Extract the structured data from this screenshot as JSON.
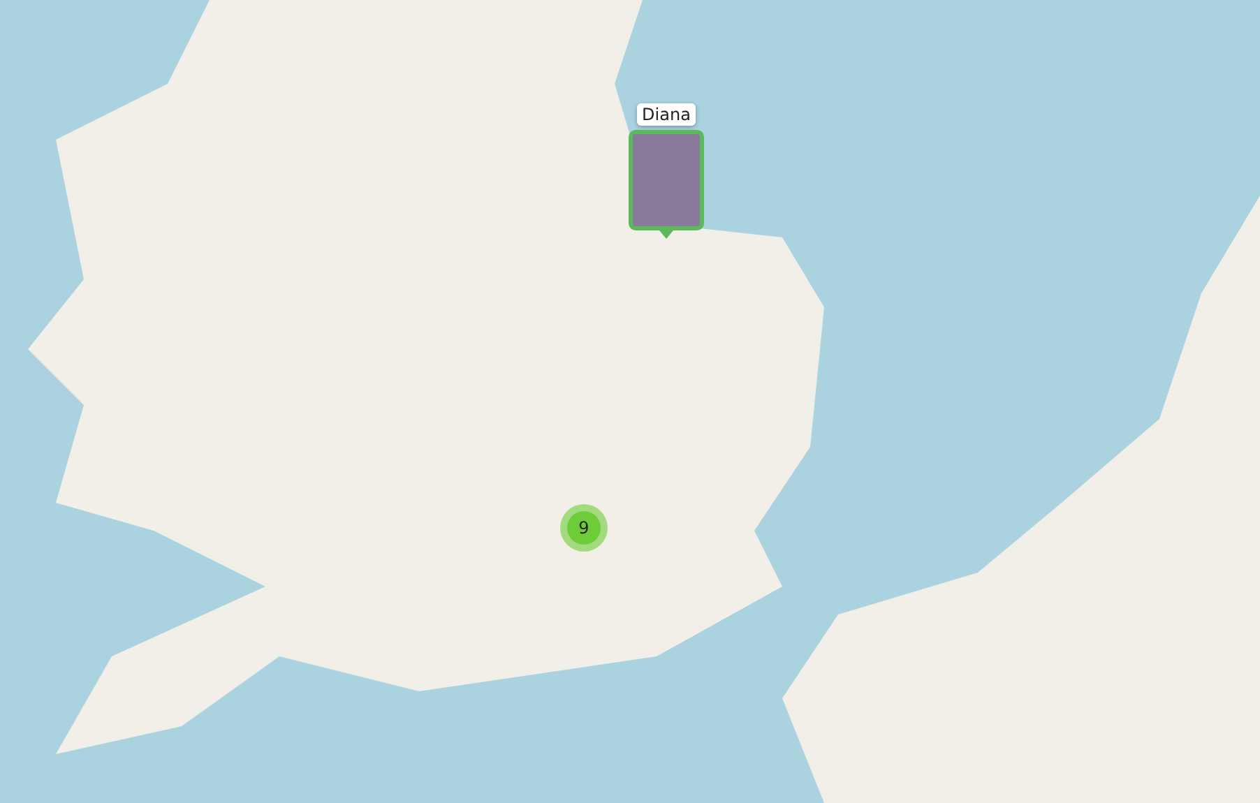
{
  "map": {
    "markers": [
      {
        "kind": "photo",
        "label": "Diana"
      },
      {
        "kind": "cluster",
        "count": "9"
      }
    ]
  }
}
